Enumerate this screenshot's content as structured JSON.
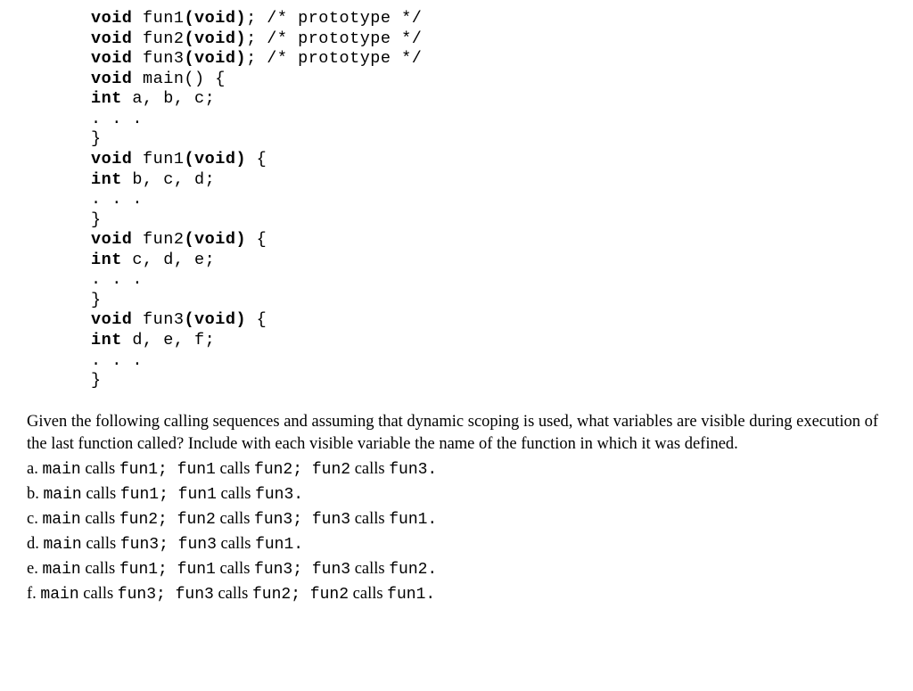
{
  "code": {
    "l1a": "void",
    "l1b": " fun1",
    "l1c": "(",
    "l1d": "void",
    "l1e": ")",
    "l1f": "; /* prototype */",
    "l2a": "void",
    "l2b": " fun2",
    "l2c": "(",
    "l2d": "void",
    "l2e": ")",
    "l2f": "; /* prototype */",
    "l3a": "void",
    "l3b": " fun3",
    "l3c": "(",
    "l3d": "void",
    "l3e": ")",
    "l3f": "; /* prototype */",
    "l4a": "void",
    "l4b": " main() {",
    "l5a": "int",
    "l5b": " a, b, c;",
    "l6": ". . .",
    "l7": "}",
    "l8a": "void",
    "l8b": " fun1",
    "l8c": "(",
    "l8d": "void",
    "l8e": ")",
    "l8f": " {",
    "l9a": "int",
    "l9b": " b, c, d;",
    "l10": ". . .",
    "l11": "}",
    "l12a": "void",
    "l12b": " fun2",
    "l12c": "(",
    "l12d": "void",
    "l12e": ")",
    "l12f": " {",
    "l13a": "int",
    "l13b": " c, d, e;",
    "l14": ". . .",
    "l15": "}",
    "l16a": "void",
    "l16b": " fun3",
    "l16c": "(",
    "l16d": "void",
    "l16e": ")",
    "l16f": " {",
    "l17a": "int",
    "l17b": " d, e, f;",
    "l18": ". . .",
    "l19": "}"
  },
  "question": "Given the following calling sequences and assuming that dynamic scoping is used, what variables are visible during execution of the last function called? Include with each visible variable the name of the function in which it was defined.",
  "opts": {
    "a": {
      "letter": "a. ",
      "p1": "main",
      "c1": "  calls ",
      "p2": "fun1; fun1",
      "c2": "  calls ",
      "p3": "fun2; fun2",
      "c3": "  calls ",
      "p4": "fun3."
    },
    "b": {
      "letter": "b. ",
      "p1": "main",
      "c1": "  calls ",
      "p2": "fun1; fun1",
      "c2": "  calls ",
      "p3": "fun3."
    },
    "c": {
      "letter": "c. ",
      "p1": "main",
      "c1": "  calls ",
      "p2": "fun2; fun2",
      "c2": "  calls ",
      "p3": "fun3; fun3",
      "c3": "  calls ",
      "p4": "fun1."
    },
    "d": {
      "letter": "d. ",
      "p1": "main",
      "c1": "  calls ",
      "p2": "fun3; fun3",
      "c2": "  calls ",
      "p3": "fun1."
    },
    "e": {
      "letter": "e. ",
      "p1": "main",
      "c1": "  calls ",
      "p2": "fun1; fun1",
      "c2": "  calls ",
      "p3": "fun3; fun3",
      "c3": "  calls ",
      "p4": "fun2."
    },
    "f": {
      "letter": "f. ",
      "p1": "main",
      "c1": "  calls ",
      "p2": "fun3; fun3",
      "c2": "  calls ",
      "p3": "fun2; fun2",
      "c3": "  calls ",
      "p4": "fun1."
    }
  }
}
